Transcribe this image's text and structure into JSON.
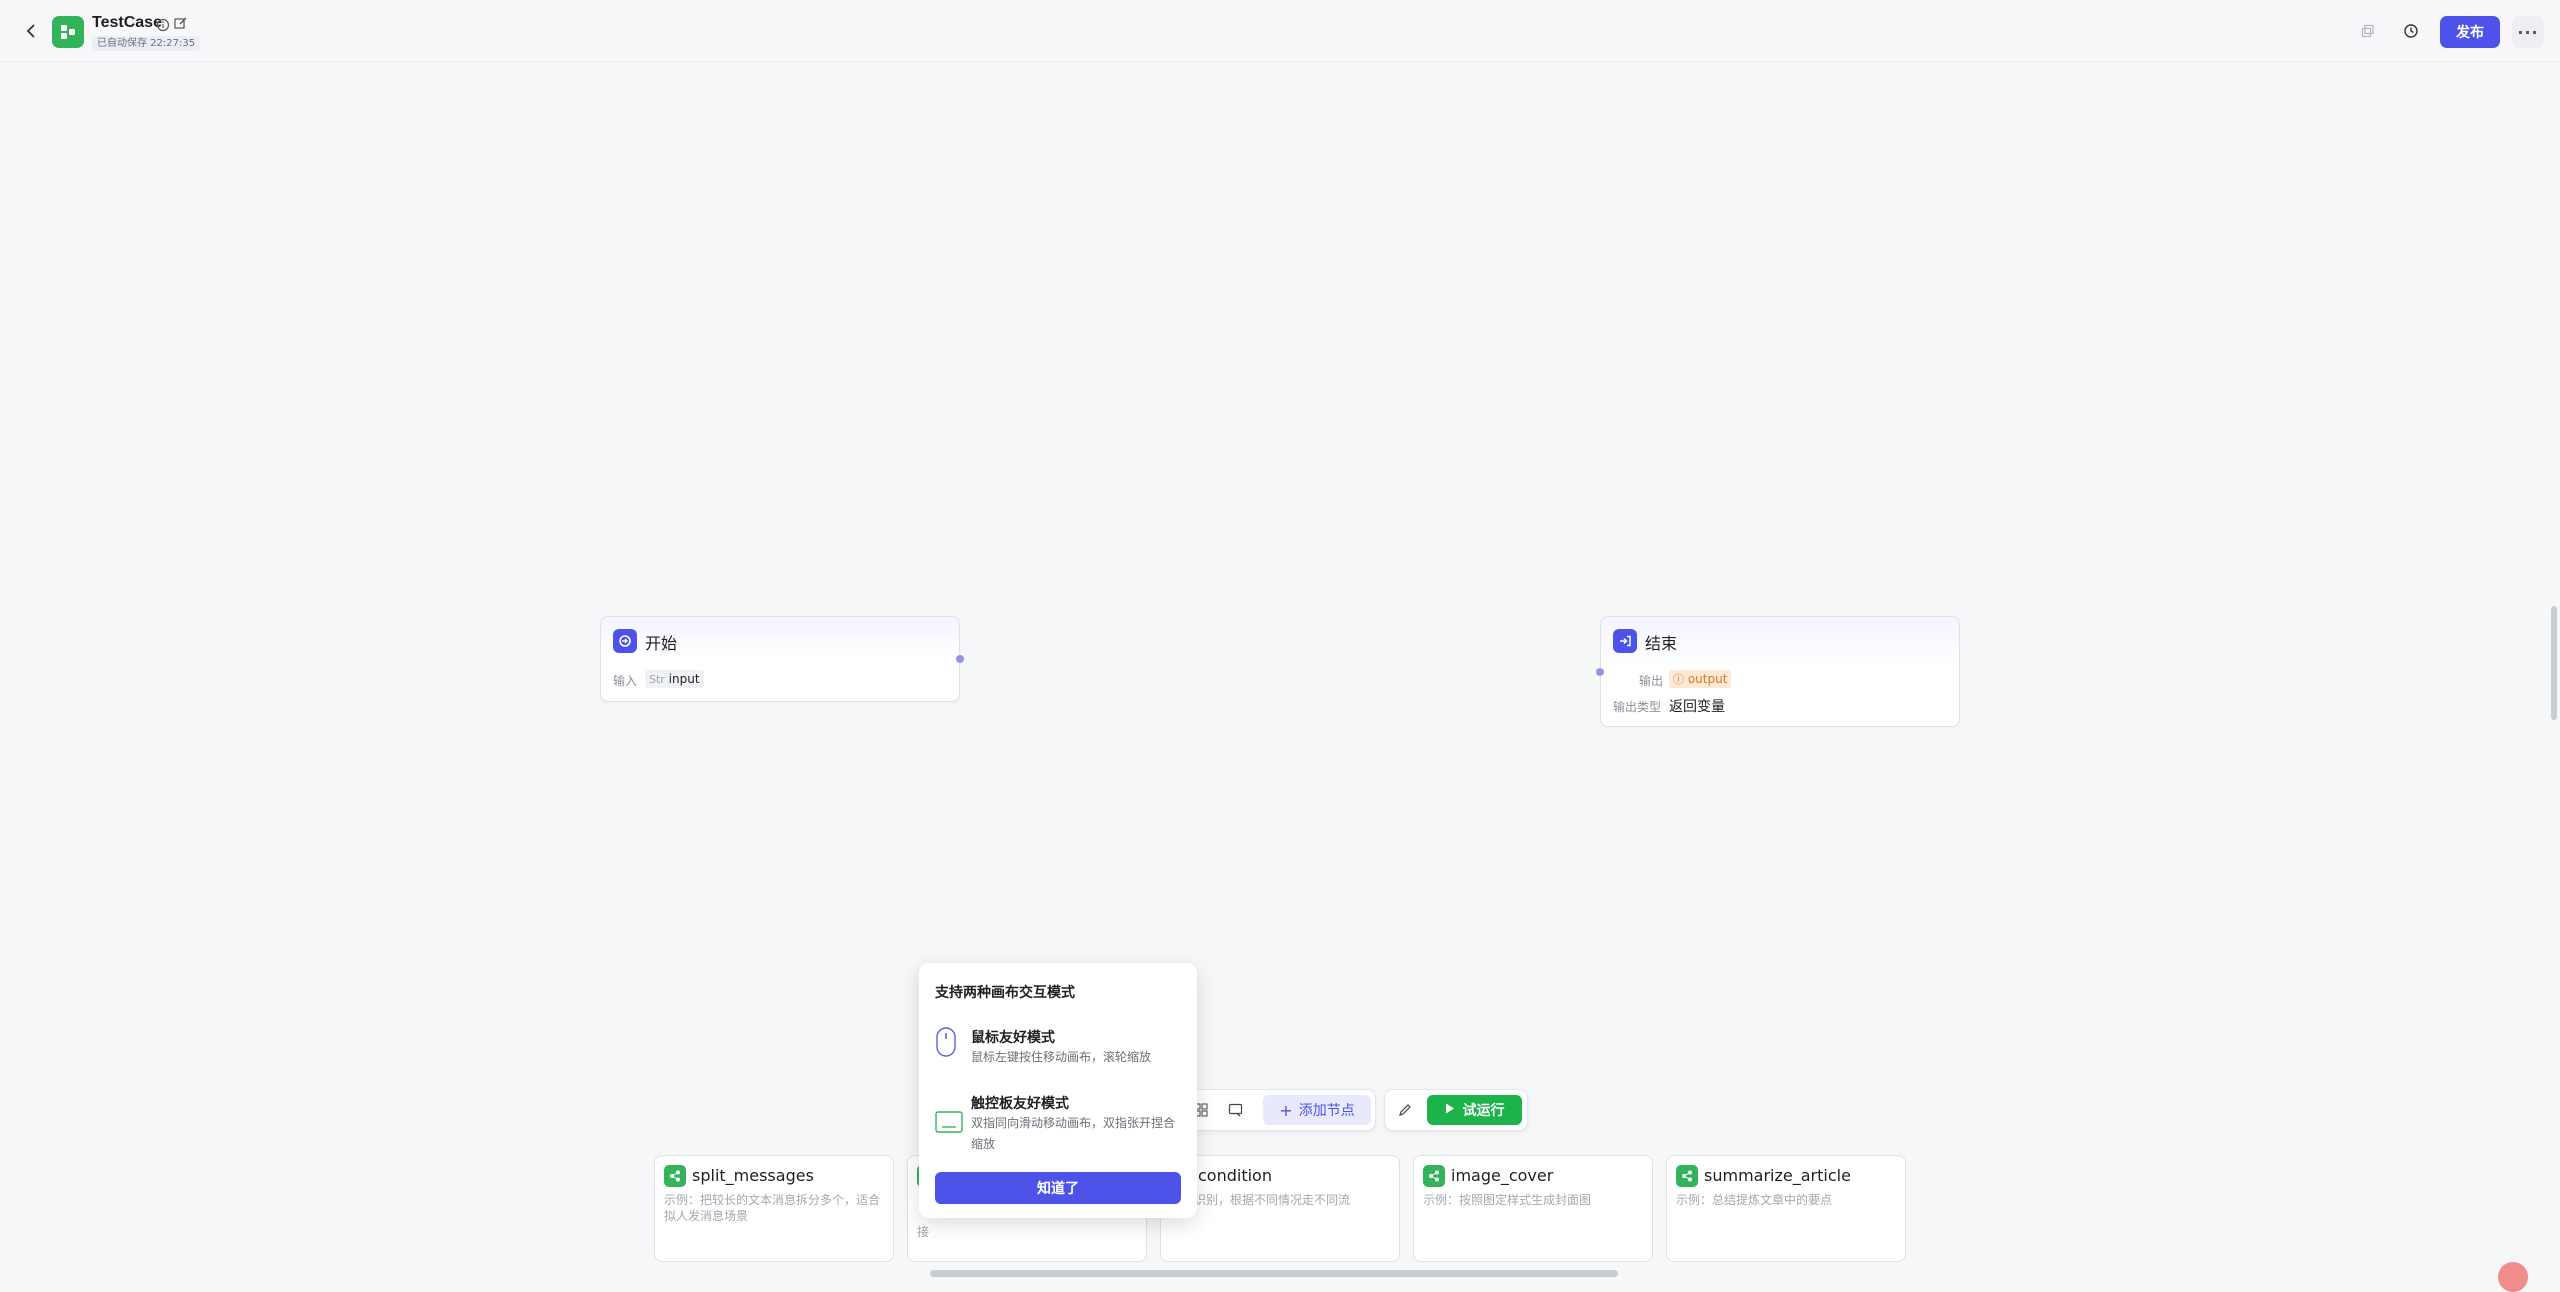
{
  "header": {
    "app_title": "TestCase",
    "save_status": "已自动保存 22:27:35",
    "publish_label": "发布",
    "more_label": "···"
  },
  "nodes": {
    "start": {
      "title": "开始",
      "input_label": "输入",
      "var_type": "Str",
      "var_name": "input"
    },
    "end": {
      "title": "结束",
      "output_label": "输出",
      "var_name": "output",
      "output_type_label": "输出类型",
      "output_type_value": "返回变量"
    }
  },
  "toolbar": {
    "add_node_label": "添加节点",
    "run_label": "试运行"
  },
  "templates": [
    {
      "title": "split_messages",
      "desc": "示例：把较长的文本消息拆分多个，适合拟人发消息场景"
    },
    {
      "title": "",
      "desc": "接"
    },
    {
      "title": "condition",
      "desc": "意图识别，根据不同情况走不同流"
    },
    {
      "title": "image_cover",
      "desc": "示例：按照图定样式生成封面图"
    },
    {
      "title": "summarize_article",
      "desc": "示例：总结提炼文章中的要点"
    }
  ],
  "popover": {
    "title": "支持两种画布交互模式",
    "mouse_title": "鼠标友好模式",
    "mouse_desc": "鼠标左键按住移动画布，滚轮缩放",
    "trackpad_title": "触控板友好模式",
    "trackpad_desc": "双指同向滑动移动画布，双指张开捏合缩放",
    "ok_label": "知道了"
  },
  "colors": {
    "brand": "#4d53e8",
    "app_green": "#33b35a",
    "run_green": "#1cb34b",
    "output_tag_bg": "#fde9d6",
    "output_tag_text": "#e07a1f"
  }
}
